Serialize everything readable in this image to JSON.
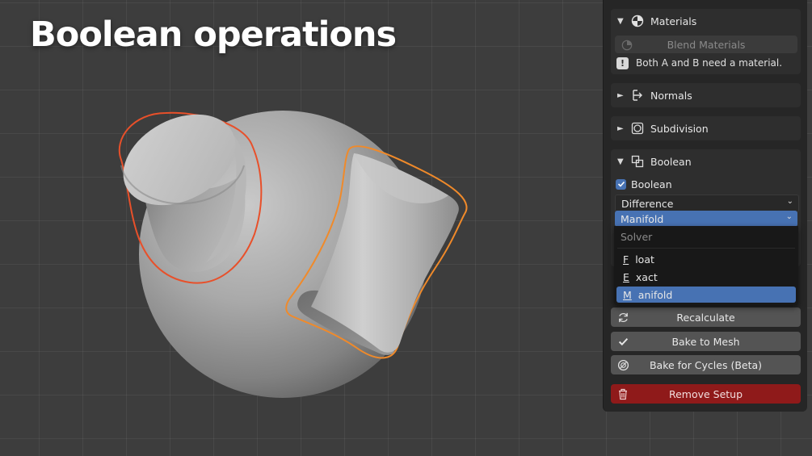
{
  "headline": "Boolean operations",
  "panel": {
    "materials": {
      "title": "Materials",
      "blend_button": "Blend Materials",
      "info_text": "Both A and B need a material."
    },
    "normals": {
      "title": "Normals"
    },
    "subdivision": {
      "title": "Subdivision"
    },
    "boolean": {
      "title": "Boolean",
      "checkbox_label": "Boolean",
      "checked": true,
      "operation": "Difference",
      "solver": "Manifold"
    },
    "buttons": {
      "recalculate": "Recalculate",
      "bake_mesh": "Bake to Mesh",
      "bake_cycles": "Bake for Cycles (Beta)",
      "remove": "Remove Setup"
    }
  },
  "solver_menu": {
    "header": "Solver",
    "options": [
      {
        "label": "Float",
        "accel": "F",
        "rest": "loat"
      },
      {
        "label": "Exact",
        "accel": "E",
        "rest": "xact"
      },
      {
        "label": "Manifold",
        "accel": "M",
        "rest": "anifold"
      }
    ],
    "selected": "Manifold"
  },
  "colors": {
    "accent": "#4772b3",
    "danger": "#8f1a1a",
    "outline_red": "#e8502a",
    "outline_orange": "#f08a2a",
    "checkbox": "#4772b3"
  },
  "icons": {
    "materials": "material-sphere-icon",
    "normals": "normals-icon",
    "subdivision": "subdivision-icon",
    "boolean": "boolean-icon",
    "info": "info-icon",
    "recalculate": "refresh-icon",
    "bake_mesh": "checkmark-icon",
    "bake_cycles": "cycles-icon",
    "remove": "trash-icon"
  }
}
